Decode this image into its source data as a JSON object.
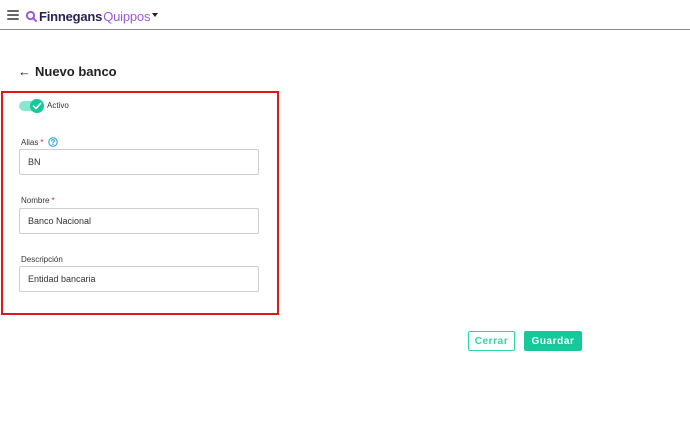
{
  "header": {
    "brand_name": "Finnegans",
    "product_name": "Quippos",
    "brand_colors": {
      "primary": "#2a2350",
      "accent": "#9b59e0"
    }
  },
  "page": {
    "back_arrow": "←",
    "title": "Nuevo banco"
  },
  "form": {
    "active_toggle": {
      "label": "Activo",
      "checked": true,
      "color": "#14c99a"
    },
    "alias": {
      "label": "Alias",
      "required_mark": "*",
      "value": "BN",
      "help_icon": "question-circle-icon"
    },
    "nombre": {
      "label": "Nombre",
      "required_mark": "*",
      "value": "Banco Nacional"
    },
    "descripcion": {
      "label": "Descripción",
      "value": "Entidad bancaria"
    },
    "highlight_color": "#e01818"
  },
  "actions": {
    "cerrar_label": "Cerrar",
    "guardar_label": "Guardar",
    "accent_color": "#14c99a"
  }
}
